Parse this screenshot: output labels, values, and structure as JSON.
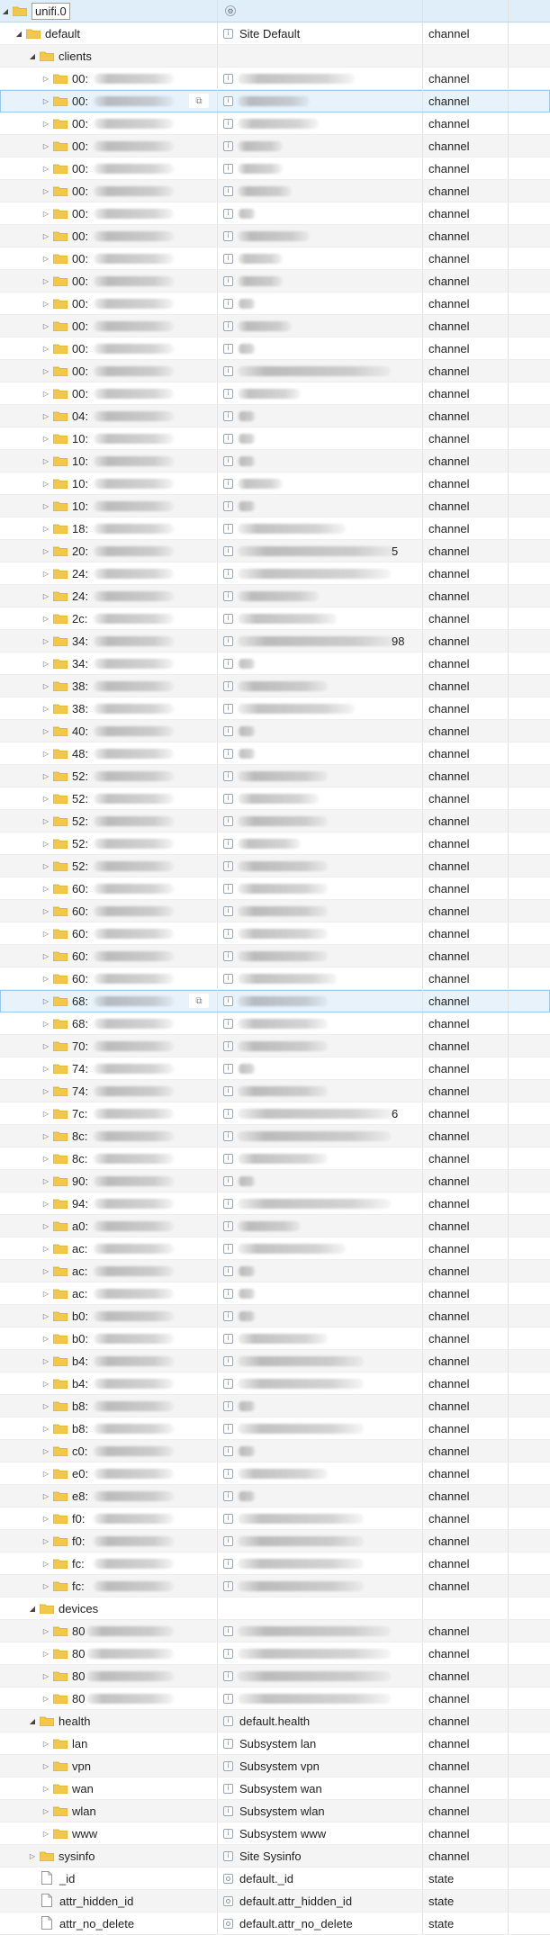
{
  "tree": {
    "root": {
      "name": "unifi.0",
      "icon": "gear-icon"
    },
    "rows": [
      {
        "d": 1,
        "t": "open",
        "k": "folder",
        "name": "default",
        "desc": "Site Default",
        "type": "channel"
      },
      {
        "d": 2,
        "t": "open",
        "k": "folder",
        "name": "clients",
        "desc": "",
        "type": ""
      },
      {
        "d": 3,
        "t": "closed",
        "k": "folder",
        "name": "00:",
        "desc": "",
        "type": "channel",
        "b": [
          80,
          130
        ]
      },
      {
        "d": 3,
        "t": "closed",
        "k": "folder",
        "name": "00:",
        "desc": "",
        "type": "channel",
        "sel": true,
        "copy": true,
        "b": [
          80,
          80
        ]
      },
      {
        "d": 3,
        "t": "closed",
        "k": "folder",
        "name": "00:",
        "desc": "",
        "type": "channel",
        "b": [
          80,
          90
        ]
      },
      {
        "d": 3,
        "t": "closed",
        "k": "folder",
        "name": "00:",
        "desc": "",
        "type": "channel",
        "b": [
          80,
          50
        ]
      },
      {
        "d": 3,
        "t": "closed",
        "k": "folder",
        "name": "00:",
        "desc": "",
        "type": "channel",
        "b": [
          80,
          50
        ]
      },
      {
        "d": 3,
        "t": "closed",
        "k": "folder",
        "name": "00:",
        "desc": "",
        "type": "channel",
        "b": [
          80,
          60
        ]
      },
      {
        "d": 3,
        "t": "closed",
        "k": "folder",
        "name": "00:",
        "desc": "",
        "type": "channel",
        "b": [
          80,
          20
        ]
      },
      {
        "d": 3,
        "t": "closed",
        "k": "folder",
        "name": "00:",
        "desc": "",
        "type": "channel",
        "b": [
          80,
          80
        ]
      },
      {
        "d": 3,
        "t": "closed",
        "k": "folder",
        "name": "00:",
        "desc": "",
        "type": "channel",
        "b": [
          80,
          50
        ]
      },
      {
        "d": 3,
        "t": "closed",
        "k": "folder",
        "name": "00:",
        "desc": "",
        "type": "channel",
        "b": [
          80,
          50
        ]
      },
      {
        "d": 3,
        "t": "closed",
        "k": "folder",
        "name": "00:",
        "desc": "",
        "type": "channel",
        "b": [
          80,
          20
        ]
      },
      {
        "d": 3,
        "t": "closed",
        "k": "folder",
        "name": "00:",
        "desc": "",
        "type": "channel",
        "b": [
          80,
          60
        ]
      },
      {
        "d": 3,
        "t": "closed",
        "k": "folder",
        "name": "00:",
        "desc": "",
        "type": "channel",
        "b": [
          80,
          20
        ]
      },
      {
        "d": 3,
        "t": "closed",
        "k": "folder",
        "name": "00:",
        "desc": "",
        "type": "channel",
        "b": [
          80,
          170
        ]
      },
      {
        "d": 3,
        "t": "closed",
        "k": "folder",
        "name": "00:",
        "desc": "",
        "type": "channel",
        "b": [
          80,
          70
        ]
      },
      {
        "d": 3,
        "t": "closed",
        "k": "folder",
        "name": "04:",
        "desc": "",
        "type": "channel",
        "b": [
          80,
          20
        ]
      },
      {
        "d": 3,
        "t": "closed",
        "k": "folder",
        "name": "10:",
        "desc": "",
        "type": "channel",
        "b": [
          80,
          20
        ]
      },
      {
        "d": 3,
        "t": "closed",
        "k": "folder",
        "name": "10:",
        "desc": "",
        "type": "channel",
        "b": [
          80,
          20
        ]
      },
      {
        "d": 3,
        "t": "closed",
        "k": "folder",
        "name": "10:",
        "desc": "",
        "type": "channel",
        "b": [
          80,
          50
        ]
      },
      {
        "d": 3,
        "t": "closed",
        "k": "folder",
        "name": "10:",
        "desc": "",
        "type": "channel",
        "b": [
          80,
          20
        ]
      },
      {
        "d": 3,
        "t": "closed",
        "k": "folder",
        "name": "18:",
        "desc": "",
        "type": "channel",
        "b": [
          80,
          120
        ]
      },
      {
        "d": 3,
        "t": "closed",
        "k": "folder",
        "name": "20:",
        "desc": "",
        "type": "channel",
        "b": [
          80,
          175
        ],
        "tail": "5"
      },
      {
        "d": 3,
        "t": "closed",
        "k": "folder",
        "name": "24:",
        "desc": "",
        "type": "channel",
        "b": [
          80,
          170
        ]
      },
      {
        "d": 3,
        "t": "closed",
        "k": "folder",
        "name": "24:",
        "desc": "",
        "type": "channel",
        "b": [
          80,
          90
        ]
      },
      {
        "d": 3,
        "t": "closed",
        "k": "folder",
        "name": "2c:",
        "desc": "",
        "type": "channel",
        "b": [
          80,
          110
        ]
      },
      {
        "d": 3,
        "t": "closed",
        "k": "folder",
        "name": "34:",
        "desc": "",
        "type": "channel",
        "b": [
          80,
          175
        ],
        "tail": "98"
      },
      {
        "d": 3,
        "t": "closed",
        "k": "folder",
        "name": "34:",
        "desc": "",
        "type": "channel",
        "b": [
          80,
          20
        ]
      },
      {
        "d": 3,
        "t": "closed",
        "k": "folder",
        "name": "38:",
        "desc": "",
        "type": "channel",
        "b": [
          80,
          100
        ]
      },
      {
        "d": 3,
        "t": "closed",
        "k": "folder",
        "name": "38:",
        "desc": "",
        "type": "channel",
        "b": [
          80,
          130
        ]
      },
      {
        "d": 3,
        "t": "closed",
        "k": "folder",
        "name": "40:",
        "desc": "",
        "type": "channel",
        "b": [
          80,
          20
        ]
      },
      {
        "d": 3,
        "t": "closed",
        "k": "folder",
        "name": "48:",
        "desc": "",
        "type": "channel",
        "b": [
          80,
          20
        ]
      },
      {
        "d": 3,
        "t": "closed",
        "k": "folder",
        "name": "52:",
        "desc": "",
        "type": "channel",
        "b": [
          80,
          100
        ]
      },
      {
        "d": 3,
        "t": "closed",
        "k": "folder",
        "name": "52:",
        "desc": "",
        "type": "channel",
        "b": [
          80,
          90
        ]
      },
      {
        "d": 3,
        "t": "closed",
        "k": "folder",
        "name": "52:",
        "desc": "",
        "type": "channel",
        "b": [
          80,
          100
        ]
      },
      {
        "d": 3,
        "t": "closed",
        "k": "folder",
        "name": "52:",
        "desc": "",
        "type": "channel",
        "b": [
          80,
          70
        ]
      },
      {
        "d": 3,
        "t": "closed",
        "k": "folder",
        "name": "52:",
        "desc": "",
        "type": "channel",
        "b": [
          80,
          100
        ]
      },
      {
        "d": 3,
        "t": "closed",
        "k": "folder",
        "name": "60:",
        "desc": "",
        "type": "channel",
        "b": [
          80,
          100
        ]
      },
      {
        "d": 3,
        "t": "closed",
        "k": "folder",
        "name": "60:",
        "desc": "",
        "type": "channel",
        "b": [
          80,
          100
        ]
      },
      {
        "d": 3,
        "t": "closed",
        "k": "folder",
        "name": "60:",
        "desc": "",
        "type": "channel",
        "b": [
          80,
          100
        ]
      },
      {
        "d": 3,
        "t": "closed",
        "k": "folder",
        "name": "60:",
        "desc": "",
        "type": "channel",
        "b": [
          80,
          100
        ]
      },
      {
        "d": 3,
        "t": "closed",
        "k": "folder",
        "name": "60:",
        "desc": "",
        "type": "channel",
        "b": [
          80,
          110
        ]
      },
      {
        "d": 3,
        "t": "closed",
        "k": "folder",
        "name": "68:",
        "desc": "",
        "type": "channel",
        "sel": true,
        "copy": true,
        "b": [
          80,
          100
        ]
      },
      {
        "d": 3,
        "t": "closed",
        "k": "folder",
        "name": "68:",
        "desc": "",
        "type": "channel",
        "b": [
          80,
          100
        ]
      },
      {
        "d": 3,
        "t": "closed",
        "k": "folder",
        "name": "70:",
        "desc": "",
        "type": "channel",
        "b": [
          80,
          100
        ]
      },
      {
        "d": 3,
        "t": "closed",
        "k": "folder",
        "name": "74:",
        "desc": "",
        "type": "channel",
        "b": [
          80,
          20
        ]
      },
      {
        "d": 3,
        "t": "closed",
        "k": "folder",
        "name": "74:",
        "desc": "",
        "type": "channel",
        "b": [
          80,
          100
        ]
      },
      {
        "d": 3,
        "t": "closed",
        "k": "folder",
        "name": "7c:",
        "desc": "",
        "type": "channel",
        "b": [
          80,
          175
        ],
        "tail": "6"
      },
      {
        "d": 3,
        "t": "closed",
        "k": "folder",
        "name": "8c:",
        "desc": "",
        "type": "channel",
        "b": [
          80,
          170
        ]
      },
      {
        "d": 3,
        "t": "closed",
        "k": "folder",
        "name": "8c:",
        "desc": "",
        "type": "channel",
        "b": [
          80,
          100
        ]
      },
      {
        "d": 3,
        "t": "closed",
        "k": "folder",
        "name": "90:",
        "desc": "",
        "type": "channel",
        "b": [
          80,
          20
        ]
      },
      {
        "d": 3,
        "t": "closed",
        "k": "folder",
        "name": "94:",
        "desc": "",
        "type": "channel",
        "b": [
          80,
          170
        ]
      },
      {
        "d": 3,
        "t": "closed",
        "k": "folder",
        "name": "a0:",
        "desc": "",
        "type": "channel",
        "b": [
          80,
          70
        ]
      },
      {
        "d": 3,
        "t": "closed",
        "k": "folder",
        "name": "ac:",
        "desc": "",
        "type": "channel",
        "b": [
          80,
          120
        ]
      },
      {
        "d": 3,
        "t": "closed",
        "k": "folder",
        "name": "ac:",
        "desc": "",
        "type": "channel",
        "b": [
          80,
          20
        ]
      },
      {
        "d": 3,
        "t": "closed",
        "k": "folder",
        "name": "ac:",
        "desc": "",
        "type": "channel",
        "b": [
          80,
          20
        ]
      },
      {
        "d": 3,
        "t": "closed",
        "k": "folder",
        "name": "b0:",
        "desc": "",
        "type": "channel",
        "b": [
          80,
          20
        ]
      },
      {
        "d": 3,
        "t": "closed",
        "k": "folder",
        "name": "b0:",
        "desc": "",
        "type": "channel",
        "b": [
          80,
          100
        ]
      },
      {
        "d": 3,
        "t": "closed",
        "k": "folder",
        "name": "b4:",
        "desc": "",
        "type": "channel",
        "b": [
          80,
          140
        ]
      },
      {
        "d": 3,
        "t": "closed",
        "k": "folder",
        "name": "b4:",
        "desc": "",
        "type": "channel",
        "b": [
          80,
          140
        ]
      },
      {
        "d": 3,
        "t": "closed",
        "k": "folder",
        "name": "b8:",
        "desc": "",
        "type": "channel",
        "b": [
          80,
          20
        ]
      },
      {
        "d": 3,
        "t": "closed",
        "k": "folder",
        "name": "b8:",
        "desc": "",
        "type": "channel",
        "b": [
          80,
          140
        ]
      },
      {
        "d": 3,
        "t": "closed",
        "k": "folder",
        "name": "c0:",
        "desc": "",
        "type": "channel",
        "b": [
          80,
          20
        ]
      },
      {
        "d": 3,
        "t": "closed",
        "k": "folder",
        "name": "e0:",
        "desc": "",
        "type": "channel",
        "b": [
          80,
          100
        ]
      },
      {
        "d": 3,
        "t": "closed",
        "k": "folder",
        "name": "e8:",
        "desc": "",
        "type": "channel",
        "b": [
          80,
          20
        ]
      },
      {
        "d": 3,
        "t": "closed",
        "k": "folder",
        "name": "f0:",
        "desc": "",
        "type": "channel",
        "b": [
          80,
          140
        ]
      },
      {
        "d": 3,
        "t": "closed",
        "k": "folder",
        "name": "f0:",
        "desc": "",
        "type": "channel",
        "b": [
          80,
          140
        ]
      },
      {
        "d": 3,
        "t": "closed",
        "k": "folder",
        "name": "fc:",
        "desc": "",
        "type": "channel",
        "b": [
          80,
          140
        ]
      },
      {
        "d": 3,
        "t": "closed",
        "k": "folder",
        "name": "fc:",
        "desc": "",
        "type": "channel",
        "b": [
          80,
          140
        ]
      },
      {
        "d": 2,
        "t": "open",
        "k": "folder",
        "name": "devices",
        "desc": "",
        "type": ""
      },
      {
        "d": 3,
        "t": "closed",
        "k": "folder",
        "name": "80",
        "desc": "",
        "type": "channel",
        "b": [
          80,
          170
        ]
      },
      {
        "d": 3,
        "t": "closed",
        "k": "folder",
        "name": "80",
        "desc": "",
        "type": "channel",
        "b": [
          80,
          170
        ]
      },
      {
        "d": 3,
        "t": "closed",
        "k": "folder",
        "name": "80",
        "desc": "",
        "type": "channel",
        "b": [
          80,
          170
        ]
      },
      {
        "d": 3,
        "t": "closed",
        "k": "folder",
        "name": "80",
        "desc": "",
        "type": "channel",
        "b": [
          80,
          170
        ]
      },
      {
        "d": 2,
        "t": "open",
        "k": "folder",
        "name": "health",
        "desc": "default.health",
        "type": "channel"
      },
      {
        "d": 3,
        "t": "closed",
        "k": "folder",
        "name": "lan",
        "desc": "Subsystem lan",
        "type": "channel"
      },
      {
        "d": 3,
        "t": "closed",
        "k": "folder",
        "name": "vpn",
        "desc": "Subsystem vpn",
        "type": "channel"
      },
      {
        "d": 3,
        "t": "closed",
        "k": "folder",
        "name": "wan",
        "desc": "Subsystem wan",
        "type": "channel"
      },
      {
        "d": 3,
        "t": "closed",
        "k": "folder",
        "name": "wlan",
        "desc": "Subsystem wlan",
        "type": "channel"
      },
      {
        "d": 3,
        "t": "closed",
        "k": "folder",
        "name": "www",
        "desc": "Subsystem www",
        "type": "channel"
      },
      {
        "d": 2,
        "t": "closed",
        "k": "folder",
        "name": "sysinfo",
        "desc": "Site Sysinfo",
        "type": "channel"
      },
      {
        "d": 2,
        "t": "none",
        "k": "state",
        "name": "_id",
        "desc": "default._id",
        "type": "state"
      },
      {
        "d": 2,
        "t": "none",
        "k": "state",
        "name": "attr_hidden_id",
        "desc": "default.attr_hidden_id",
        "type": "state"
      },
      {
        "d": 2,
        "t": "none",
        "k": "state",
        "name": "attr_no_delete",
        "desc": "default.attr_no_delete",
        "type": "state"
      }
    ]
  },
  "colors": {
    "folder": "#f2c84a",
    "folder_dark": "#d9a92b",
    "selection": "#e8f2fb"
  }
}
